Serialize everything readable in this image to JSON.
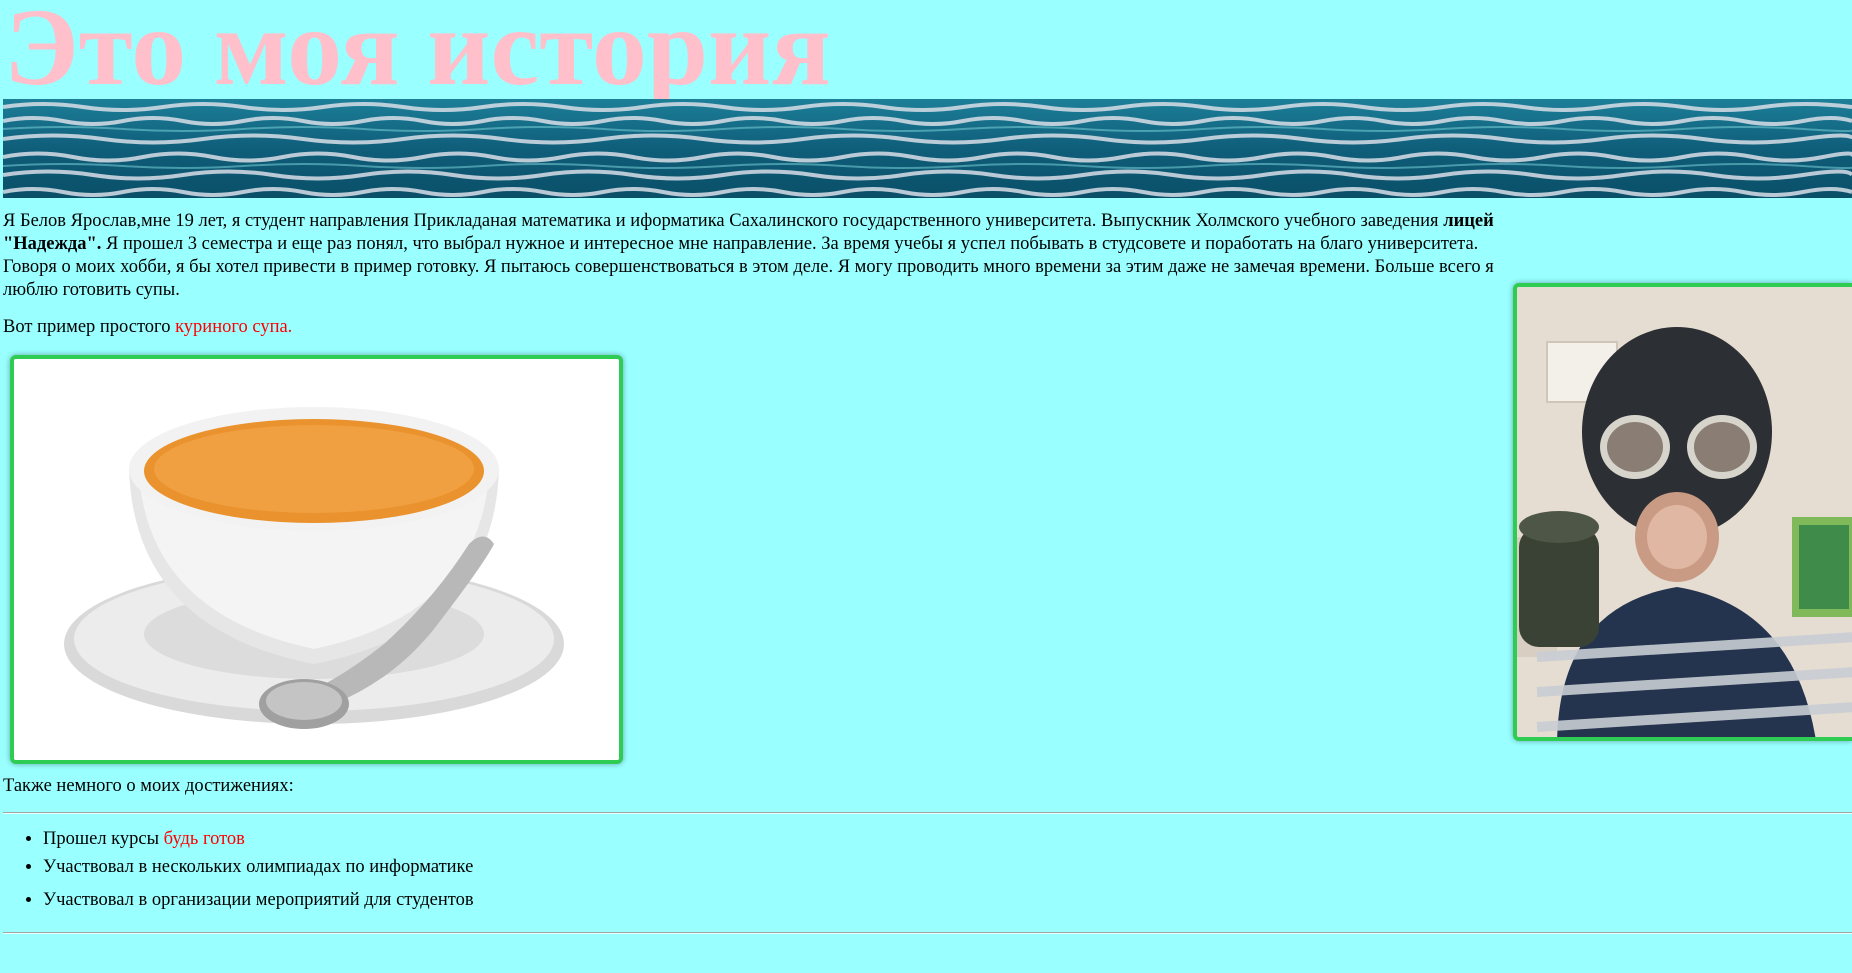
{
  "header": {
    "title": "Это моя история"
  },
  "intro": {
    "text_before_bold": "Я Белов Ярослав,мне 19 лет, я студент направления Прикладаная математика и иформатика Сахалинского государственного университета. Выпускник Холмского учебного заведения ",
    "bold": "лицей \"Надежда\".",
    "text_after_bold": " Я прошел 3 семестра и еще раз понял, что выбрал нужное и интересное мне направление. За время учебы я успел побывать в студсовете и поработать на благо университета. Говоря о моих хобби, я бы хотел привести в пример готовку. Я пытаюсь совершенствоваться в этом деле. Я могу проводить много времени за этим даже не замечая времени. Больше всего я люблю готовить супы."
  },
  "soup": {
    "text": "Вот пример простого ",
    "link_label": "куриного супа."
  },
  "achievements": {
    "heading": "Также немного о моих достижениях:",
    "items": [
      {
        "text": "Прошел курсы ",
        "link_label": "будь готов"
      },
      {
        "text": "Участвовал в нескольких олимпиадах по информатике",
        "link_label": ""
      },
      {
        "text": "Участвовал в организации мероприятий для студентов",
        "link_label": ""
      }
    ]
  },
  "colors": {
    "background": "#99ffff",
    "title": "#ffc0cb",
    "link": "#ff0000",
    "image_border": "#2ecc52"
  },
  "images": {
    "banner": "water-banner",
    "soup": "soup-bowl-photo",
    "portrait": "gas-mask-portrait-photo"
  }
}
